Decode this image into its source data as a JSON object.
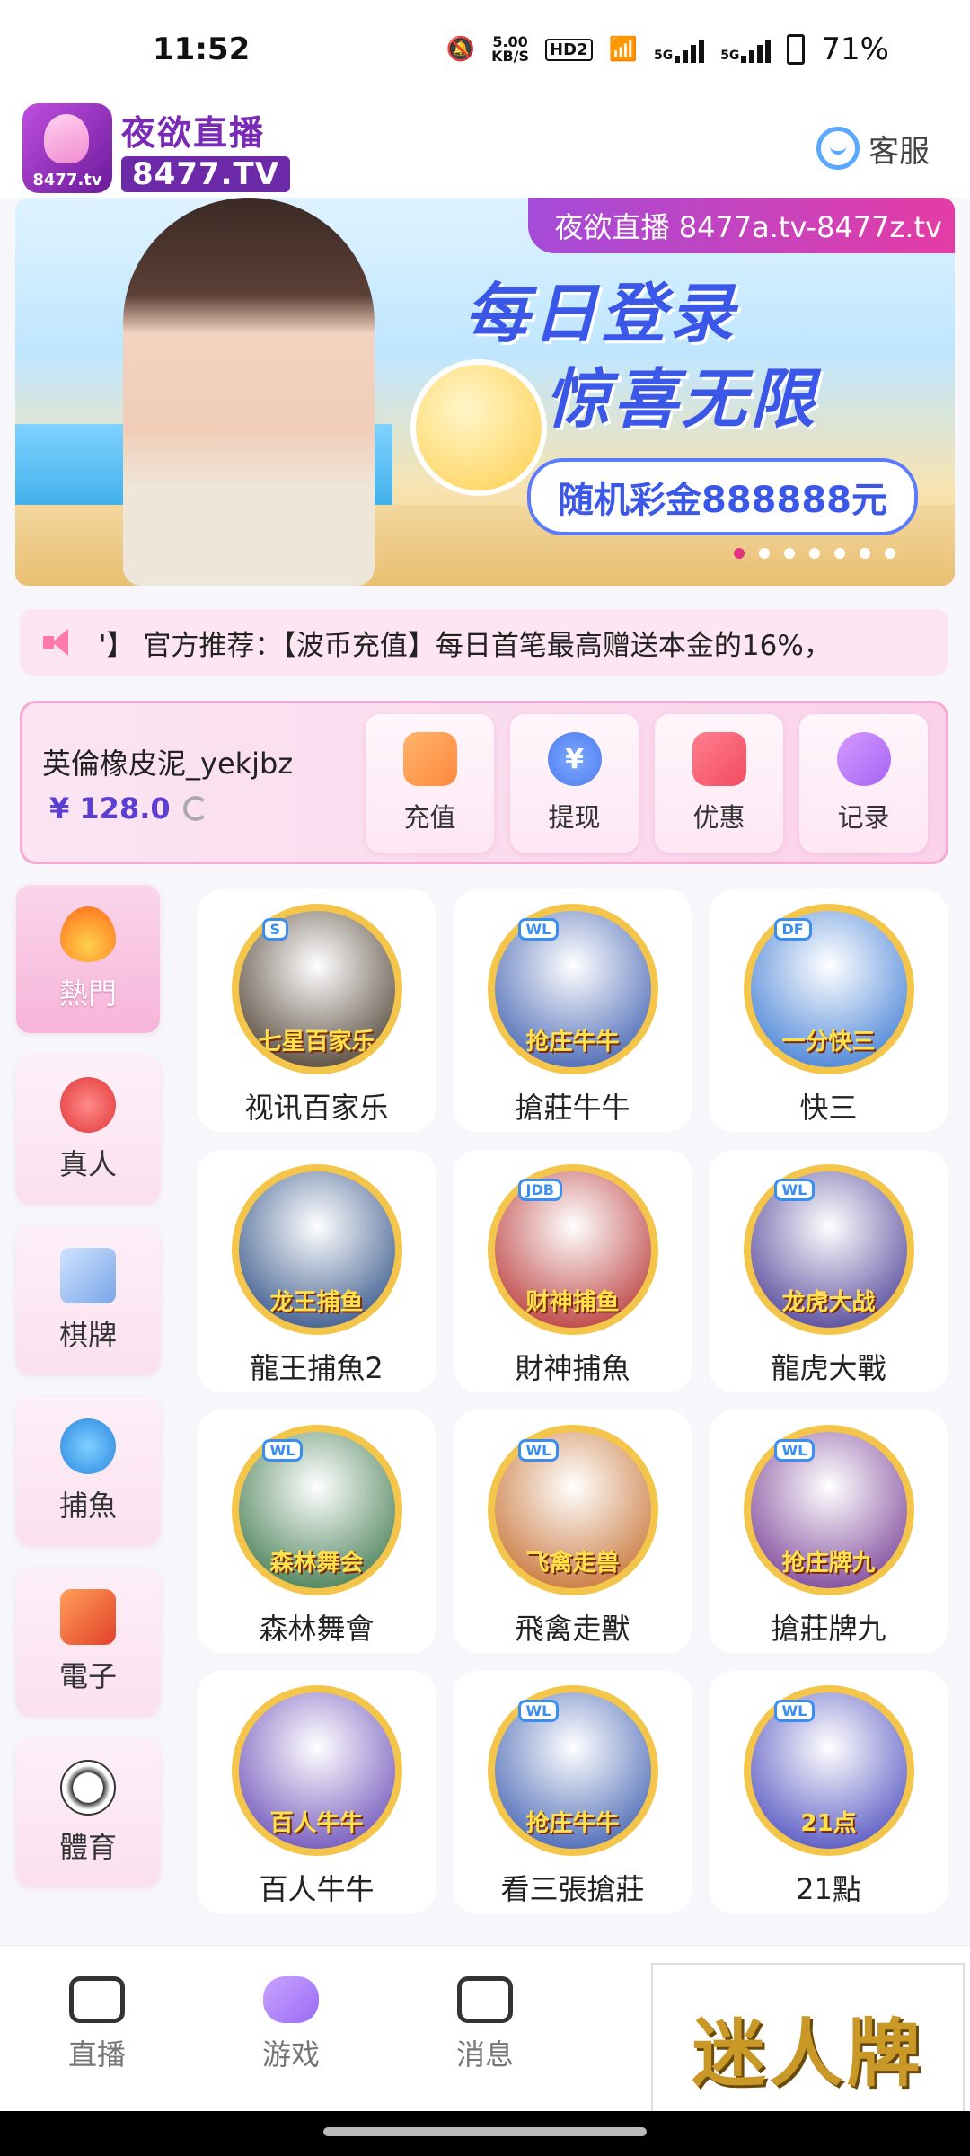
{
  "status_bar": {
    "time": "11:52",
    "speed_value": "5.00",
    "speed_unit": "KB/S",
    "hd": "HD2",
    "net1": "5G",
    "net2": "5G",
    "battery": "71%"
  },
  "header": {
    "logo_badge": "8477.tv",
    "logo_title": "夜欲直播",
    "logo_sub": "8477.TV",
    "service_label": "客服"
  },
  "banner": {
    "tagline": "夜欲直播 8477a.tv-8477z.tv",
    "headline_1": "每日登录",
    "headline_2": "惊喜无限",
    "prize": "随机彩金888888元",
    "dots_total": 7,
    "active_dot": 1
  },
  "marquee": {
    "text": "'】 官方推荐：【波币充值】每日首笔最高赠送本金的16%，"
  },
  "wallet": {
    "username": "英倫橡皮泥_yekjbz",
    "balance": "¥ 128.0",
    "actions": [
      {
        "label": "充值",
        "icon": "wallet-icon"
      },
      {
        "label": "提现",
        "icon": "yen-icon",
        "glyph": "¥"
      },
      {
        "label": "优惠",
        "icon": "ticket-icon"
      },
      {
        "label": "记录",
        "icon": "gamepad-icon"
      }
    ]
  },
  "categories": [
    {
      "label": "熱門",
      "icon": "flame-icon",
      "active": true
    },
    {
      "label": "真人",
      "icon": "chip-icon",
      "active": false
    },
    {
      "label": "棋牌",
      "icon": "cards-icon",
      "active": false
    },
    {
      "label": "捕魚",
      "icon": "shark-icon",
      "active": false
    },
    {
      "label": "電子",
      "icon": "slot-777-icon",
      "active": false
    },
    {
      "label": "體育",
      "icon": "soccer-ball-icon",
      "active": false
    }
  ],
  "games": [
    {
      "name": "视讯百家乐",
      "art_title": "七星百家乐",
      "tag": "S",
      "bg": "#3a2a1a"
    },
    {
      "name": "搶莊牛牛",
      "art_title": "抢庄牛牛",
      "tag": "WL",
      "bg": "#2a4ea8"
    },
    {
      "name": "快三",
      "art_title": "一分快三",
      "tag": "DF",
      "bg": "#2a6ed0"
    },
    {
      "name": "龍王捕魚2",
      "art_title": "龙王捕鱼",
      "tag": "",
      "bg": "#1b3f7a"
    },
    {
      "name": "財神捕魚",
      "art_title": "财神捕鱼",
      "tag": "JDB",
      "bg": "#b02020"
    },
    {
      "name": "龍虎大戰",
      "art_title": "龙虎大战",
      "tag": "WL",
      "bg": "#3a2a8a"
    },
    {
      "name": "森林舞會",
      "art_title": "森林舞会",
      "tag": "WL",
      "bg": "#2a6a3a"
    },
    {
      "name": "飛禽走獸",
      "art_title": "飞禽走兽",
      "tag": "WL",
      "bg": "#c0601a"
    },
    {
      "name": "搶莊牌九",
      "art_title": "抢庄牌九",
      "tag": "WL",
      "bg": "#6a2a8a"
    },
    {
      "name": "百人牛牛",
      "art_title": "百人牛牛",
      "tag": "",
      "bg": "#5a3ab0"
    },
    {
      "name": "看三張搶莊",
      "art_title": "抢庄牛牛",
      "tag": "WL",
      "bg": "#2a4ea8"
    },
    {
      "name": "21點",
      "art_title": "21点",
      "tag": "WL",
      "bg": "#3a3ab8"
    }
  ],
  "bottom_nav": [
    {
      "label": "直播",
      "icon": "camera-icon"
    },
    {
      "label": "游戏",
      "icon": "gamepad-icon"
    },
    {
      "label": "消息",
      "icon": "message-icon"
    }
  ],
  "overlay_ad": "迷人牌",
  "colors": {
    "brand_purple": "#6d2aa8",
    "pink_accent": "#f6a9d4",
    "balance": "#5a3fd0"
  }
}
